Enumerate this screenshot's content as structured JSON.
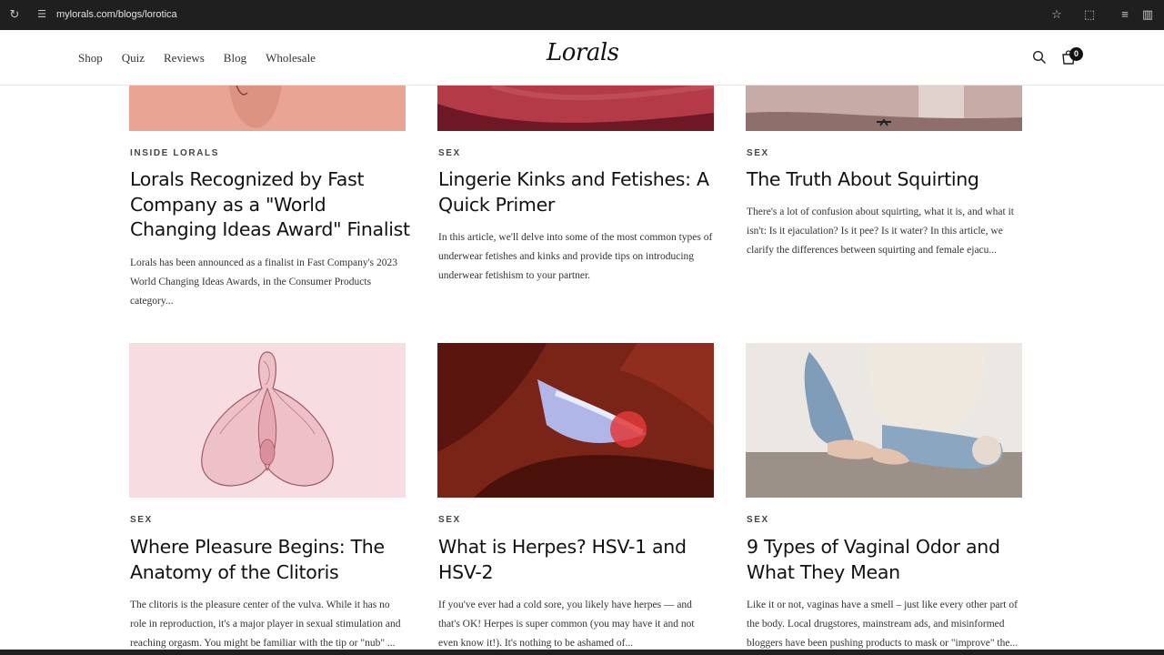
{
  "browser": {
    "url": "mylorals.com/blogs/lorotica"
  },
  "header": {
    "nav": [
      "Shop",
      "Quiz",
      "Reviews",
      "Blog",
      "Wholesale"
    ],
    "logo": "Lorals",
    "cart_count": "0"
  },
  "posts": [
    {
      "category": "INSIDE LORALS",
      "title": "Lorals Recognized by Fast Company as a \"World Changing Ideas Award\" Finalist",
      "excerpt": "Lorals has been announced as a finalist in Fast Company's 2023 World Changing Ideas Awards, in the Consumer Products category..."
    },
    {
      "category": "SEX",
      "title": "Lingerie Kinks and Fetishes: A Quick Primer",
      "excerpt": "In this article, we'll delve into some of the most common types of underwear fetishes and kinks and provide tips on introducing underwear fetishism to your partner."
    },
    {
      "category": "SEX",
      "title": "The Truth About Squirting",
      "excerpt": "There's a lot of confusion about squirting, what it is, and what it isn't: Is it ejaculation? Is it pee? Is it water? In this article, we clarify the differences between squirting and female ejacu..."
    },
    {
      "category": "SEX",
      "title": "Where Pleasure Begins: The Anatomy of the Clitoris",
      "excerpt": "The clitoris is the pleasure center of the vulva. While it has no role in reproduction, it's a major player in sexual stimulation and reaching orgasm.  You might be familiar with the tip or \"nub\" ..."
    },
    {
      "category": "SEX",
      "title": "What is Herpes? HSV-1 and HSV-2",
      "excerpt": "If you've ever had a cold sore, you likely have herpes — and that's OK! Herpes is super common (you may have it and not even know it!). It's nothing to be ashamed of..."
    },
    {
      "category": "SEX",
      "title": "9 Types of Vaginal Odor and What They Mean",
      "excerpt": "Like it or not, vaginas have a smell – just like every other part of the body.  Local drugstores, mainstream ads, and misinformed bloggers have been pushing products to mask or \"improve\" the..."
    }
  ]
}
